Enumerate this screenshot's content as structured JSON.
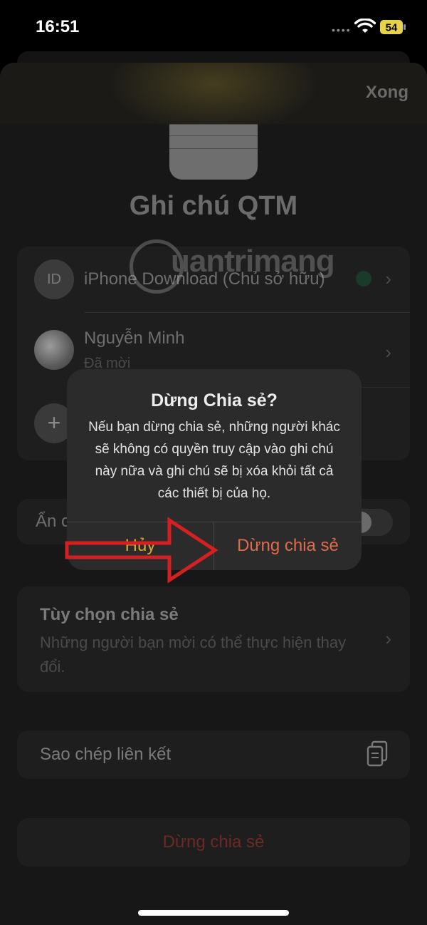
{
  "status_bar": {
    "time": "16:51",
    "battery": "54"
  },
  "header": {
    "done_label": "Xong"
  },
  "note": {
    "title": "Ghi chú QTM"
  },
  "participants": [
    {
      "initials": "ID",
      "name": "iPhone Download (Chủ sở hữu)",
      "subtitle": ""
    },
    {
      "initials": "",
      "name": "Nguyễn Minh",
      "subtitle": "Đã mời"
    }
  ],
  "add_participant": {
    "icon": "plus-icon"
  },
  "hide_row": {
    "label": "Ẩn c"
  },
  "share_options": {
    "title": "Tùy chọn chia sẻ",
    "description": "Những người bạn mời có thể thực hiện thay đổi."
  },
  "copy_link": {
    "label": "Sao chép liên kết",
    "icon": "copy-icon"
  },
  "stop_sharing": {
    "label": "Dừng chia sẻ"
  },
  "watermark": {
    "text": "uantrimang"
  },
  "alert": {
    "title": "Dừng Chia sẻ?",
    "message": "Nếu bạn dừng chia sẻ, những người khác sẽ không có quyền truy cập vào ghi chú này nữa và ghi chú sẽ bị xóa khỏi tất cả các thiết bị của họ.",
    "cancel_label": "Hủy",
    "confirm_label": "Dừng chia sẻ"
  },
  "colors": {
    "alert_confirm": "#e06a4e",
    "alert_cancel": "#d9a530",
    "annotation_arrow": "#d42020"
  }
}
